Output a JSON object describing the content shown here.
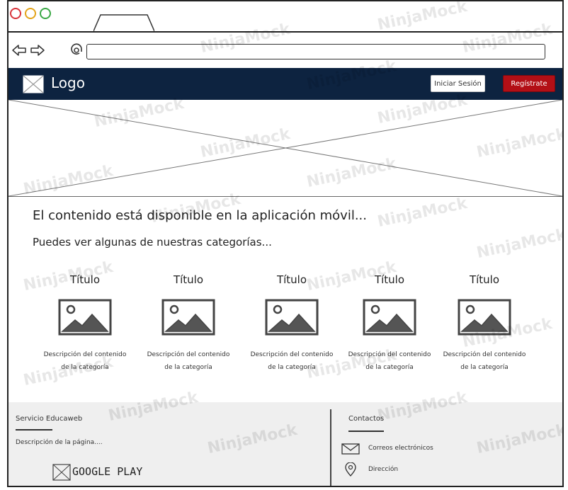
{
  "browser": {
    "url": ""
  },
  "header": {
    "logo_text": "Logo",
    "login_label": "Iniciar Sesión",
    "register_label": "Regístrate",
    "bg_color": "#0d2340",
    "register_color": "#b30f16"
  },
  "main": {
    "heading": "El contenido está disponible en la aplicación móvil...",
    "subheading": "Puedes ver algunas de nuestras categorías..."
  },
  "categories": [
    {
      "title": "Título",
      "desc_line1": "Descripción del contenido",
      "desc_line2": "de la categoría"
    },
    {
      "title": "Título",
      "desc_line1": "Descripción del contenido",
      "desc_line2": "de la categoría"
    },
    {
      "title": "Título",
      "desc_line1": "Descripción del contenido",
      "desc_line2": "de la categoría"
    },
    {
      "title": "Título",
      "desc_line1": "Descripción del contenido",
      "desc_line2": "de la categoría"
    },
    {
      "title": "Título",
      "desc_line1": "Descripción del contenido",
      "desc_line2": "de la categoría"
    }
  ],
  "footer": {
    "service_title": "Servicio Educaweb",
    "description": "Descripción de la página....",
    "google_play": "GOOGLE PLAY",
    "contacts_title": "Contactos",
    "email_label": "Correos electrónicos",
    "address_label": "Dirección"
  },
  "watermark": "NinjaMock",
  "icons": [
    "browser-back-icon",
    "browser-forward-icon",
    "url-at-icon",
    "logo-placeholder-icon",
    "image-placeholder-icon",
    "mail-icon",
    "location-pin-icon"
  ]
}
